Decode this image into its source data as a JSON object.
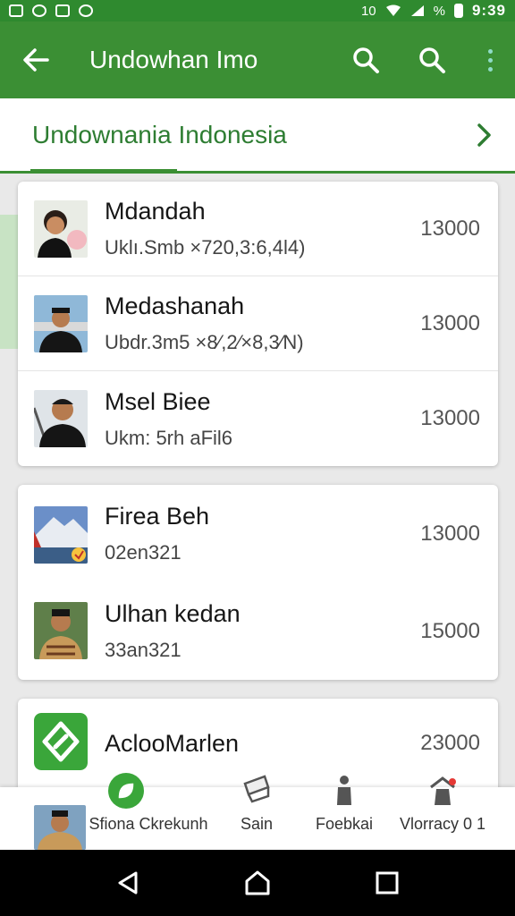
{
  "statusbar": {
    "time": "9:39",
    "signal_text": "10",
    "battery_text": "%"
  },
  "appbar": {
    "title": "Undowhan Imo"
  },
  "tab": {
    "label": "Undownania Indonesia"
  },
  "cards": [
    {
      "rows": [
        {
          "title": "Mdandah",
          "subtitle": "Uklı.Smb ×720,3:6,4l4)",
          "amount": "13000"
        },
        {
          "title": "Medashanah",
          "subtitle": "Ubdr.3m5 ×8⁄,2⁄×8,3⁄N)",
          "amount": "13000"
        },
        {
          "title": "Msel Biee",
          "subtitle": "Ukm: 5rh aFil6",
          "amount": "13000"
        }
      ]
    },
    {
      "rows": [
        {
          "title": "Firea Beh",
          "subtitle": "02en321",
          "amount": "13000"
        },
        {
          "title": "Ulhan kedan",
          "subtitle": "33an321",
          "amount": "15000"
        }
      ]
    },
    {
      "rows": [
        {
          "title": "AcloоMarlen",
          "subtitle": "",
          "amount": "23000"
        }
      ]
    }
  ],
  "bottom_nav": [
    {
      "label": "Sfiona Ckrekunh",
      "icon": "leaf-icon"
    },
    {
      "label": "Sain",
      "icon": "tag-icon"
    },
    {
      "label": "Foebkai",
      "icon": "person-icon"
    },
    {
      "label": "Vlorracy 0 1",
      "icon": "person-alert-icon"
    }
  ],
  "colors": {
    "primary": "#3b8f34",
    "tab_text": "#2e7d32",
    "accent": "#8fdcc8"
  }
}
